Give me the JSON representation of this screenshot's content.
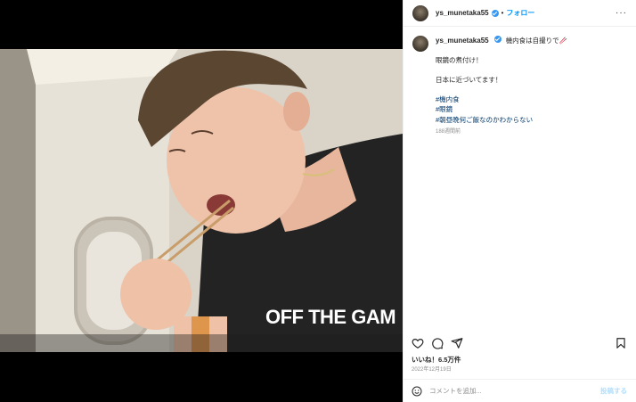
{
  "post": {
    "username": "ys_munetaka55",
    "follow_label": "フォロー",
    "dot": "•",
    "more": "···"
  },
  "caption": {
    "username": "ys_munetaka55",
    "line1": "機内食は自撮りで🥢",
    "line2": "眼鏡の煮付け！",
    "line3": "日本に近づいてます！",
    "hashtags": [
      "#機内食",
      "#眼鏡",
      "#朝昼晩何ご飯なのかわからない"
    ],
    "time_ago": "188週間前"
  },
  "photo": {
    "shirt_text": "OFF THE GAM"
  },
  "engagement": {
    "likes": "いいね！6.5万件",
    "date": "2022年12月19日"
  },
  "comment": {
    "placeholder": "コメントを追加...",
    "post_label": "投稿する"
  },
  "icons": {
    "heart": "heart-icon",
    "comment": "comment-icon",
    "share": "share-icon",
    "save": "bookmark-icon",
    "emoji": "emoji-icon"
  },
  "colors": {
    "follow": "#0095f6",
    "hashtag": "#00376b",
    "verified": "#3897f0"
  }
}
